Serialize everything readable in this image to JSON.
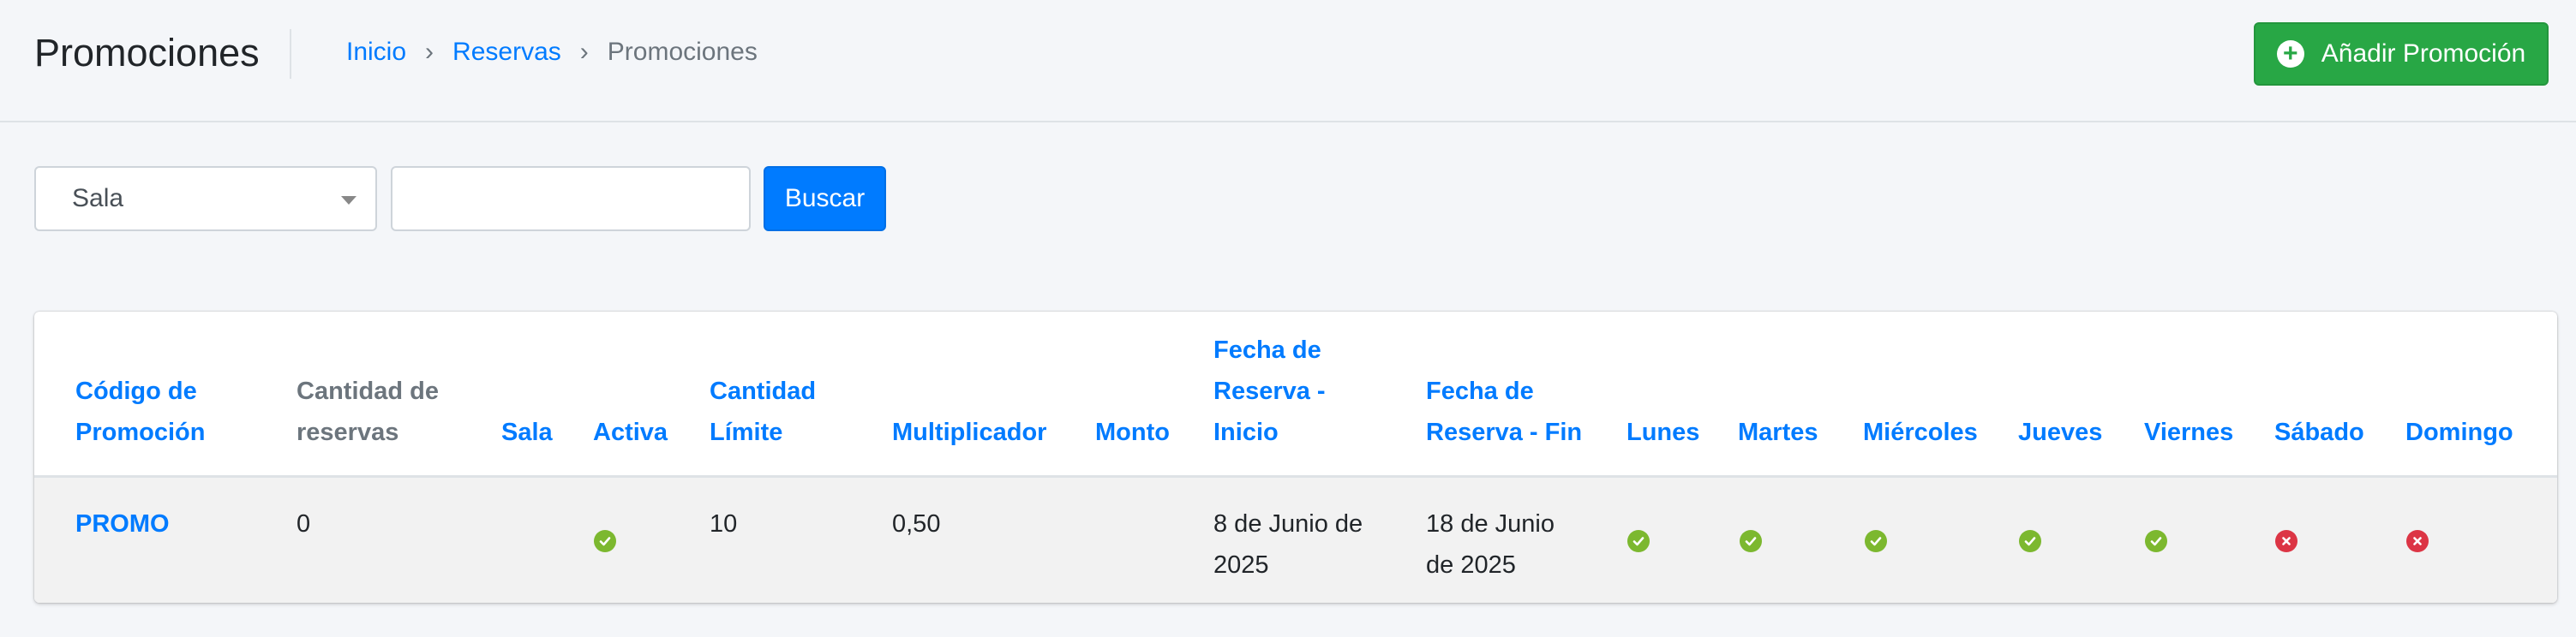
{
  "header": {
    "title": "Promociones",
    "breadcrumb": [
      {
        "label": "Inicio"
      },
      {
        "label": "Reservas"
      },
      {
        "label": "Promociones"
      }
    ],
    "separator": "›",
    "add_button_label": "Añadir Promoción",
    "add_button_icon": "plus-circle-icon"
  },
  "filters": {
    "select_value": "Sala",
    "input_value": "",
    "search_label": "Buscar"
  },
  "table": {
    "columns": [
      "Código de Promoción",
      "Cantidad de reservas",
      "Sala",
      "Activa",
      "Cantidad Límite",
      "Multiplicador",
      "Monto",
      "Fecha de Reserva - Inicio",
      "Fecha de Reserva - Fin",
      "Lunes",
      "Martes",
      "Miércoles",
      "Jueves",
      "Viernes",
      "Sábado",
      "Domingo"
    ],
    "rows": [
      {
        "code": "PROMO",
        "cantidad_reservas": "0",
        "sala": "",
        "activa": true,
        "cantidad_limite": "10",
        "multiplicador": "0,50",
        "monto": "",
        "fecha_inicio": "8 de Junio de 2025",
        "fecha_fin": "18 de Junio de 2025",
        "lunes": true,
        "martes": true,
        "miercoles": true,
        "jueves": true,
        "viernes": true,
        "sabado": false,
        "domingo": false
      }
    ]
  },
  "colors": {
    "primary": "#007bff",
    "success": "#28a745",
    "check": "#7cb82f",
    "danger": "#dc3545",
    "background": "#f4f6f9"
  }
}
